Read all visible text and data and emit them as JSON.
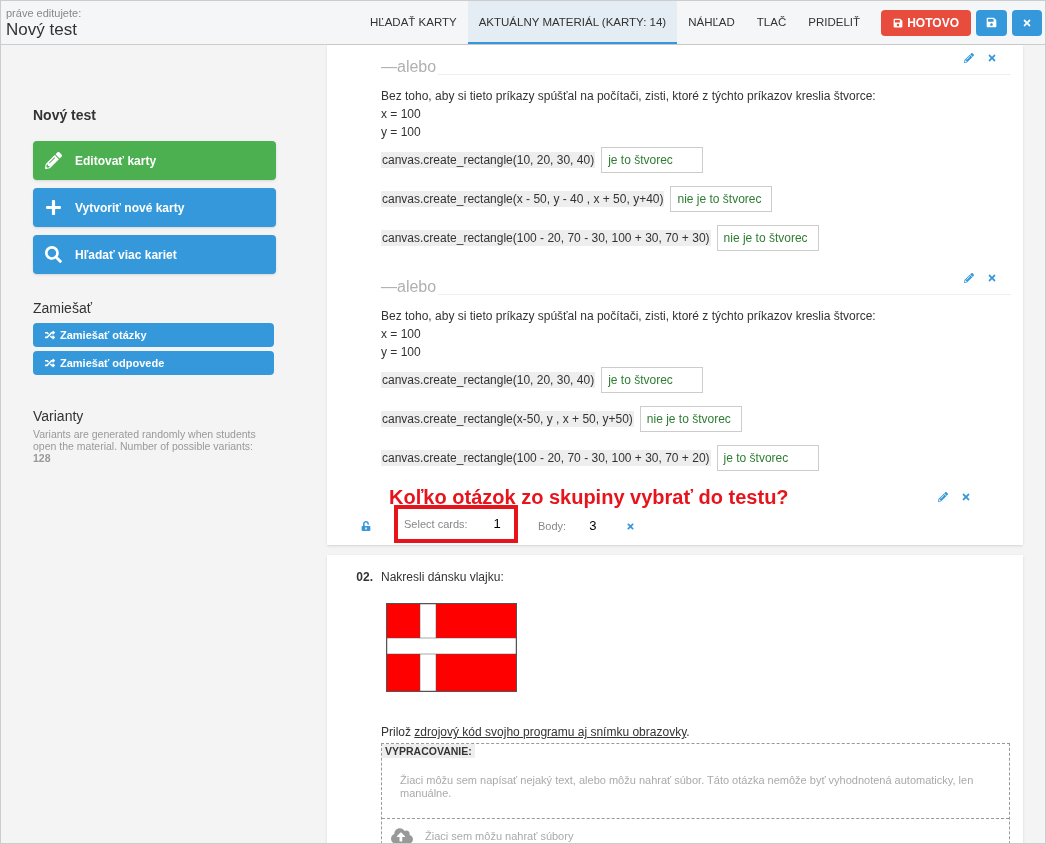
{
  "header": {
    "subtitle": "práve editujete:",
    "title": "Nový test"
  },
  "tabs": [
    {
      "label": "HĽADAŤ KARTY",
      "selected": false
    },
    {
      "label": "AKTUÁLNY MATERIÁL (KARTY: 14)",
      "selected": true
    },
    {
      "label": "NÁHĽAD",
      "selected": false
    },
    {
      "label": "TLAČ",
      "selected": false
    },
    {
      "label": "PRIDELIŤ",
      "selected": false
    }
  ],
  "actions": [
    {
      "kind": "done",
      "label": "HOTOVO"
    },
    {
      "kind": "save"
    },
    {
      "kind": "close"
    }
  ],
  "sidebar": {
    "title": "Nový test",
    "buttons": [
      {
        "kind": "edit",
        "label": "Editovať karty"
      },
      {
        "kind": "create",
        "label": "Vytvoriť nové karty"
      },
      {
        "kind": "search",
        "label": "Hľadať viac kariet"
      }
    ],
    "shuffle_heading": "Zamiešať",
    "shuffle_buttons": [
      "Zamiešať otázky",
      "Zamiešať odpovede"
    ],
    "variants_heading": "Varianty",
    "variants_text": "Variants are generated randomly when students open the material. Number of possible variants: **128**"
  },
  "group": {
    "cards": [
      {
        "separator": "—alebo",
        "prompt": "Bez toho, aby si tieto príkazy spúšťal na počítači, zisti, ktoré z týchto príkazov kreslia štvorce:",
        "lines": [
          "x = 100",
          "y = 100"
        ],
        "answers": [
          {
            "code": "canvas.create_rectangle(10, 20, 30, 40)",
            "value": "je to štvorec"
          },
          {
            "code": "canvas.create_rectangle(x - 50, y - 40 , x + 50, y+40)",
            "value": "nie je to štvorec"
          },
          {
            "code": "canvas.create_rectangle(100 - 20, 70 - 30, 100 + 30, 70 + 30)",
            "value": "nie je to štvorec"
          }
        ]
      },
      {
        "separator": "—alebo",
        "prompt": "Bez toho, aby si tieto príkazy spúšťal na počítači, zisti, ktoré z týchto príkazov kreslia štvorce:",
        "lines": [
          "x = 100",
          "y = 100"
        ],
        "answers": [
          {
            "code": "canvas.create_rectangle(10, 20, 30, 40)",
            "value": "je to štvorec"
          },
          {
            "code": "canvas.create_rectangle(x-50, y , x + 50, y+50)",
            "value": "nie je to štvorec"
          },
          {
            "code": "canvas.create_rectangle(100 - 20, 70 - 30, 100 + 30, 70 + 20)",
            "value": "je to štvorec"
          }
        ]
      }
    ],
    "annotation": "Koľko otázok zo skupiny vybrať do testu?",
    "footer": {
      "select_label": "Select cards:",
      "select_value": "1",
      "points_label": "Body:",
      "points_value": "3"
    }
  },
  "question": {
    "number": "02.",
    "prompt": "Nakresli dánsku vlajku:",
    "caption_before": "Prilož ",
    "caption_link": "zdrojový kód svojho programu aj snímku obrazovky",
    "caption_after": ".",
    "answer_box": {
      "label": "VYPRACOVANIE:",
      "hint": "Žiaci môžu sem napísať nejaký text, alebo môžu nahrať súbor. Táto otázka nemôže byť vyhodnotená automaticky, len manuálne.",
      "upload_hint": "Žiaci sem môžu nahrať súbory"
    }
  }
}
